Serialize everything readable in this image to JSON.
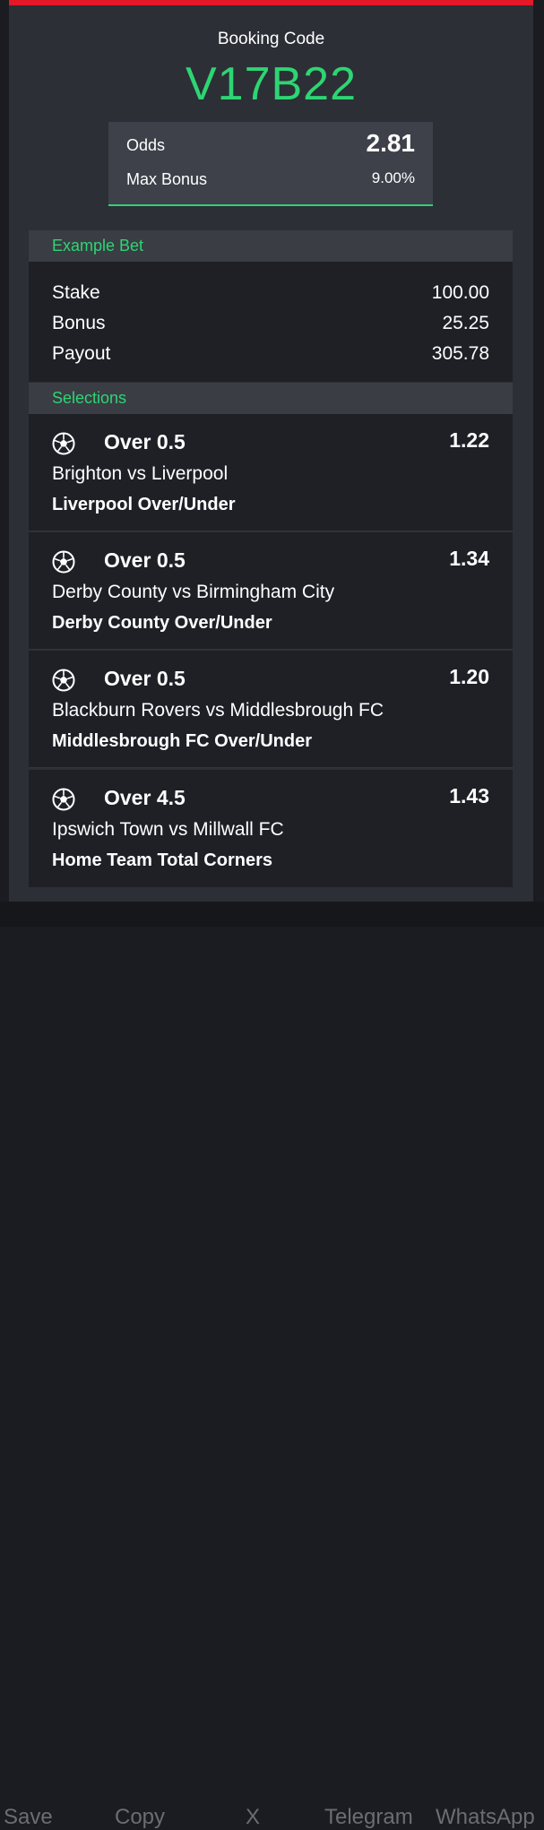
{
  "header": {
    "booking_label": "Booking Code",
    "booking_code": "V17B22",
    "accent_color": "#e41827",
    "code_color": "#2ed573"
  },
  "summary": {
    "odds_label": "Odds",
    "odds_value": "2.81",
    "max_bonus_label": "Max Bonus",
    "max_bonus_value": "9.00%"
  },
  "example_bet": {
    "title": "Example Bet",
    "rows": [
      {
        "label": "Stake",
        "value": "100.00"
      },
      {
        "label": "Bonus",
        "value": "25.25"
      },
      {
        "label": "Payout",
        "value": "305.78"
      }
    ]
  },
  "selections": {
    "title": "Selections",
    "icon": "soccer-ball-icon",
    "items": [
      {
        "pick": "Over 0.5",
        "odds": "1.22",
        "match": "Brighton vs Liverpool",
        "market": "Liverpool Over/Under"
      },
      {
        "pick": "Over 0.5",
        "odds": "1.34",
        "match": "Derby County vs Birmingham City",
        "market": "Derby County Over/Under"
      },
      {
        "pick": "Over 0.5",
        "odds": "1.20",
        "match": "Blackburn Rovers vs Middlesbrough FC",
        "market": "Middlesbrough FC Over/Under"
      },
      {
        "pick": "Over 4.5",
        "odds": "1.43",
        "match": "Ipswich Town vs Millwall FC",
        "market": "Home Team Total Corners"
      }
    ]
  },
  "background_actions": [
    "Save",
    "Copy",
    "X",
    "Telegram",
    "WhatsApp"
  ]
}
